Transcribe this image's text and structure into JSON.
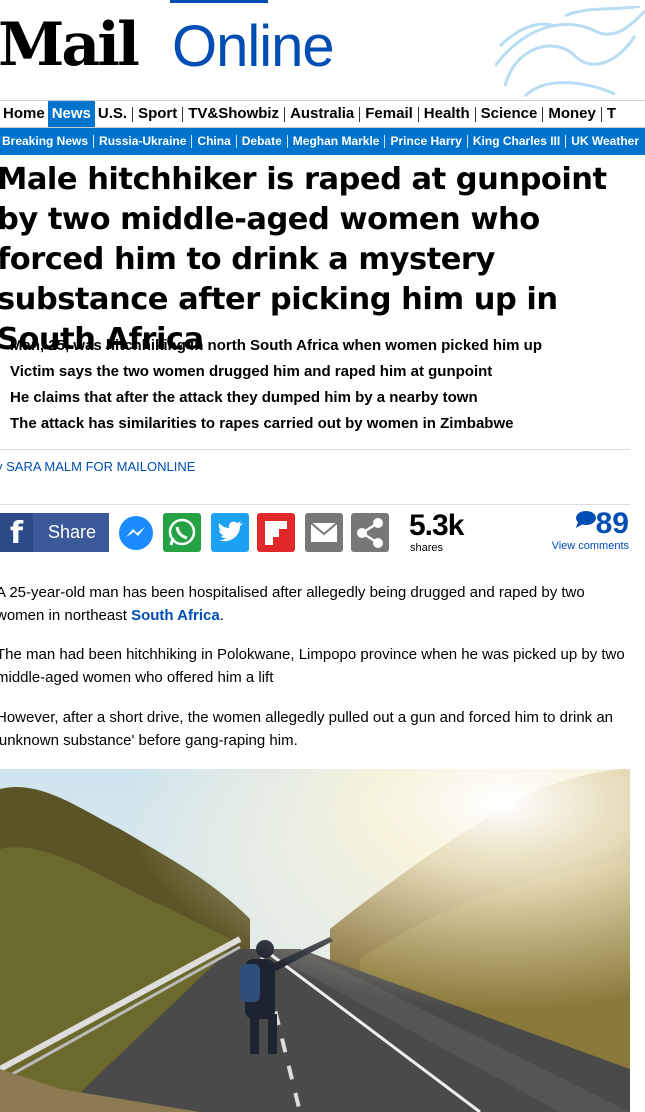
{
  "masthead": {
    "brand_mail": "Mail",
    "brand_online": "Online"
  },
  "nav_primary": [
    {
      "label": "Home",
      "active": false
    },
    {
      "label": "News",
      "active": true
    },
    {
      "label": "U.S.",
      "active": false
    },
    {
      "label": "Sport",
      "active": false
    },
    {
      "label": "TV&Showbiz",
      "active": false
    },
    {
      "label": "Australia",
      "active": false
    },
    {
      "label": "Femail",
      "active": false
    },
    {
      "label": "Health",
      "active": false
    },
    {
      "label": "Science",
      "active": false
    },
    {
      "label": "Money",
      "active": false
    },
    {
      "label": "T",
      "active": false
    }
  ],
  "nav_secondary": [
    "Breaking News",
    "Russia-Ukraine",
    "China",
    "Debate",
    "Meghan Markle",
    "Prince Harry",
    "King Charles III",
    "UK Weather"
  ],
  "article": {
    "headline": "Male hitchhiker is raped at gunpoint by two middle-aged women who forced him to drink a mystery substance after picking him up in South Africa",
    "bullets": [
      "Man, 25, was hitchhiking in north South Africa when women picked him up",
      "Victim says the two women drugged him and raped him at gunpoint",
      "He claims that after the attack they dumped him by a nearby town",
      "The attack has similarities to rapes carried out by women in Zimbabwe"
    ],
    "byline_prefix": "y",
    "byline_author": "SARA MALM FOR MAILONLINE",
    "paragraphs": {
      "p1_before": "A 25-year-old man has been hospitalised after allegedly being drugged and raped by two women in northeast ",
      "p1_link": "South Africa",
      "p1_after": ".",
      "p2": "The man had been hitchhiking in Polokwane, Limpopo province when he was picked up by two middle-aged women who offered him a lift",
      "p3": "However, after a short drive, the women allegedly pulled out a gun and forced him to drink an 'unknown substance' before gang-raping him."
    }
  },
  "share": {
    "facebook_label": "Share",
    "icons": [
      "facebook-icon",
      "messenger-icon",
      "whatsapp-icon",
      "twitter-icon",
      "flipboard-icon",
      "email-icon",
      "share-icon"
    ],
    "share_count": "5.3k",
    "share_count_label": "shares",
    "comment_count": "89",
    "comments_label": "View comments"
  },
  "colors": {
    "brand_blue": "#004db3",
    "nav_blue": "#0074cc",
    "facebook": "#3b5998"
  }
}
